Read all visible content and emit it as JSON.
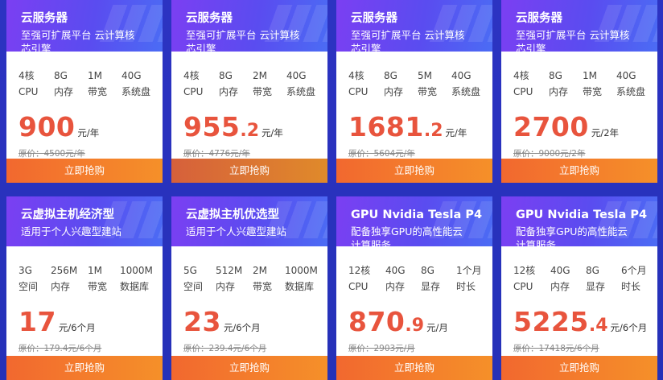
{
  "products": [
    {
      "title": "云服务器",
      "subtitle": "至强可扩展平台 云计算核芯引擎",
      "specs": [
        [
          "4核",
          "CPU"
        ],
        [
          "8G",
          "内存"
        ],
        [
          "1M",
          "带宽"
        ],
        [
          "40G",
          "系统盘"
        ]
      ],
      "price_int": "900",
      "price_dec": "",
      "unit": "元/年",
      "original": "原价：4500元/年",
      "button": "立即抢购"
    },
    {
      "title": "云服务器",
      "subtitle": "至强可扩展平台 云计算核芯引擎",
      "specs": [
        [
          "4核",
          "CPU"
        ],
        [
          "8G",
          "内存"
        ],
        [
          "2M",
          "带宽"
        ],
        [
          "40G",
          "系统盘"
        ]
      ],
      "price_int": "955",
      "price_dec": ".2",
      "unit": "元/年",
      "original": "原价：4776元/年",
      "button": "立即抢购"
    },
    {
      "title": "云服务器",
      "subtitle": "至强可扩展平台 云计算核芯引擎",
      "specs": [
        [
          "4核",
          "CPU"
        ],
        [
          "8G",
          "内存"
        ],
        [
          "5M",
          "带宽"
        ],
        [
          "40G",
          "系统盘"
        ]
      ],
      "price_int": "1681",
      "price_dec": ".2",
      "unit": "元/年",
      "original": "原价：5604元/年",
      "button": "立即抢购"
    },
    {
      "title": "云服务器",
      "subtitle": "至强可扩展平台 云计算核芯引擎",
      "specs": [
        [
          "4核",
          "CPU"
        ],
        [
          "8G",
          "内存"
        ],
        [
          "1M",
          "带宽"
        ],
        [
          "40G",
          "系统盘"
        ]
      ],
      "price_int": "2700",
      "price_dec": "",
      "unit": "元/2年",
      "original": "原价：9000元/2年",
      "button": "立即抢购"
    },
    {
      "title": "云虚拟主机经济型",
      "subtitle": "适用于个人兴趣型建站",
      "specs": [
        [
          "3G",
          "空间"
        ],
        [
          "256M",
          "内存"
        ],
        [
          "1M",
          "带宽"
        ],
        [
          "1000M",
          "数据库"
        ]
      ],
      "price_int": "17",
      "price_dec": "",
      "unit": "元/6个月",
      "original": "原价：179.4元/6个月",
      "button": "立即抢购"
    },
    {
      "title": "云虚拟主机优选型",
      "subtitle": "适用于个人兴趣型建站",
      "specs": [
        [
          "5G",
          "空间"
        ],
        [
          "512M",
          "内存"
        ],
        [
          "2M",
          "带宽"
        ],
        [
          "1000M",
          "数据库"
        ]
      ],
      "price_int": "23",
      "price_dec": "",
      "unit": "元/6个月",
      "original": "原价：239.4元/6个月",
      "button": "立即抢购"
    },
    {
      "title": "GPU Nvidia Tesla P4",
      "subtitle": "配备独享GPU的高性能云计算服务",
      "specs": [
        [
          "12核",
          "CPU"
        ],
        [
          "40G",
          "内存"
        ],
        [
          "8G",
          "显存"
        ],
        [
          "1个月",
          "时长"
        ]
      ],
      "price_int": "870",
      "price_dec": ".9",
      "unit": "元/月",
      "original": "原价：2903元/月",
      "button": "立即抢购"
    },
    {
      "title": "GPU Nvidia Tesla P4",
      "subtitle": "配备独享GPU的高性能云计算服务",
      "specs": [
        [
          "12核",
          "CPU"
        ],
        [
          "40G",
          "内存"
        ],
        [
          "8G",
          "显存"
        ],
        [
          "6个月",
          "时长"
        ]
      ],
      "price_int": "5225",
      "price_dec": ".4",
      "unit": "元/6个月",
      "original": "原价：17418元/6个月",
      "button": "立即抢购"
    }
  ]
}
